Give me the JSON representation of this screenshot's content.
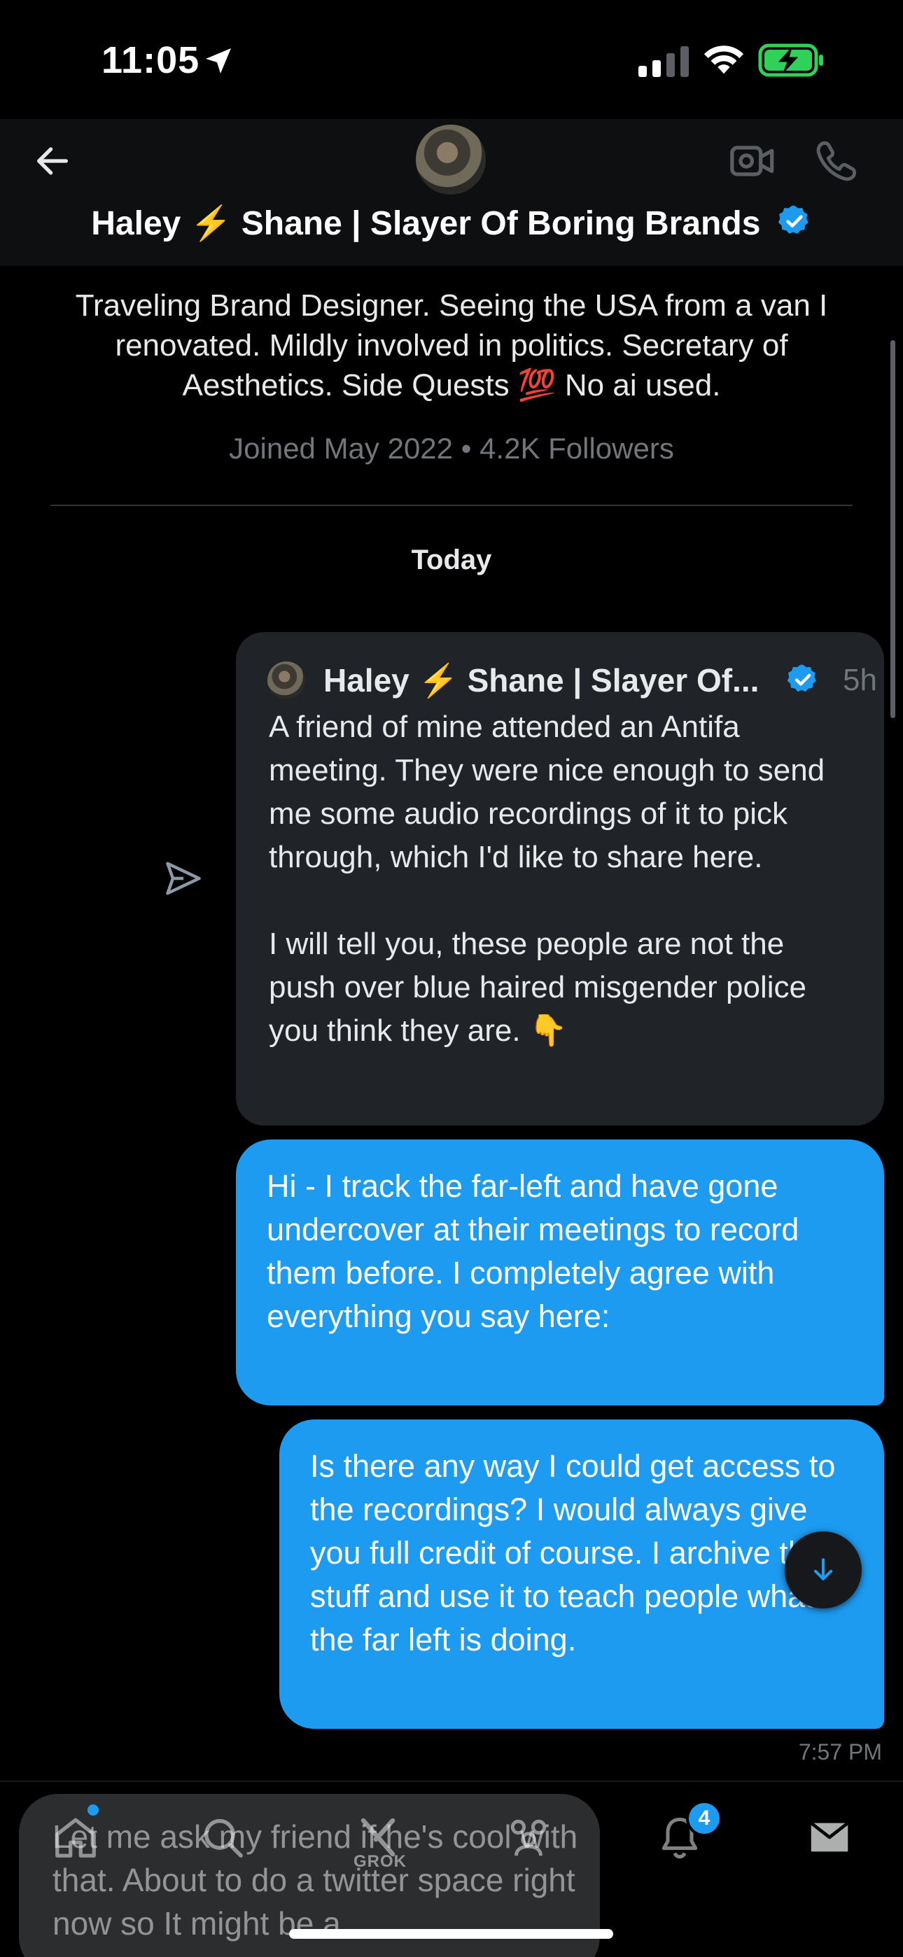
{
  "status_bar": {
    "time": "11:05"
  },
  "header": {
    "name": "Haley ⚡️ Shane | Slayer Of Boring Brands"
  },
  "profile": {
    "bio": "Traveling Brand Designer. Seeing the USA from a van I renovated. Mildly involved in politics. Secretary of Aesthetics. Side Quests 💯 No ai used.",
    "meta": "Joined May 2022 • 4.2K Followers"
  },
  "conversation": {
    "date_label": "Today",
    "shared_post": {
      "author": "Haley ⚡️ Shane | Slayer Of...",
      "age": "5h",
      "text": "A friend of mine attended an Antifa meeting. They were nice enough to send me some audio recordings of it to pick through, which I'd like to share here.\n\nI will tell you, these people are not the push over blue haired misgender police you think they are.  👇"
    },
    "messages": [
      {
        "text": "Hi - I track the far-left and have gone undercover at their meetings to record them before. I completely agree with everything you say here:"
      },
      {
        "text": "Is there any way I could get access to the recordings? I would always give you full credit of course. I archive this stuff and use it to teach people what the far left is doing."
      }
    ],
    "last_time": "7:57 PM"
  },
  "composer": {
    "draft_text": "Let me ask my friend if he's cool with that. About to do a twitter space right now so It might be a"
  },
  "tab_bar": {
    "grok_label": "GROK",
    "notifications_count": "4"
  },
  "colors": {
    "accent": "#1d9bf0",
    "card": "#202327",
    "background": "#000000",
    "muted": "#71767b"
  }
}
